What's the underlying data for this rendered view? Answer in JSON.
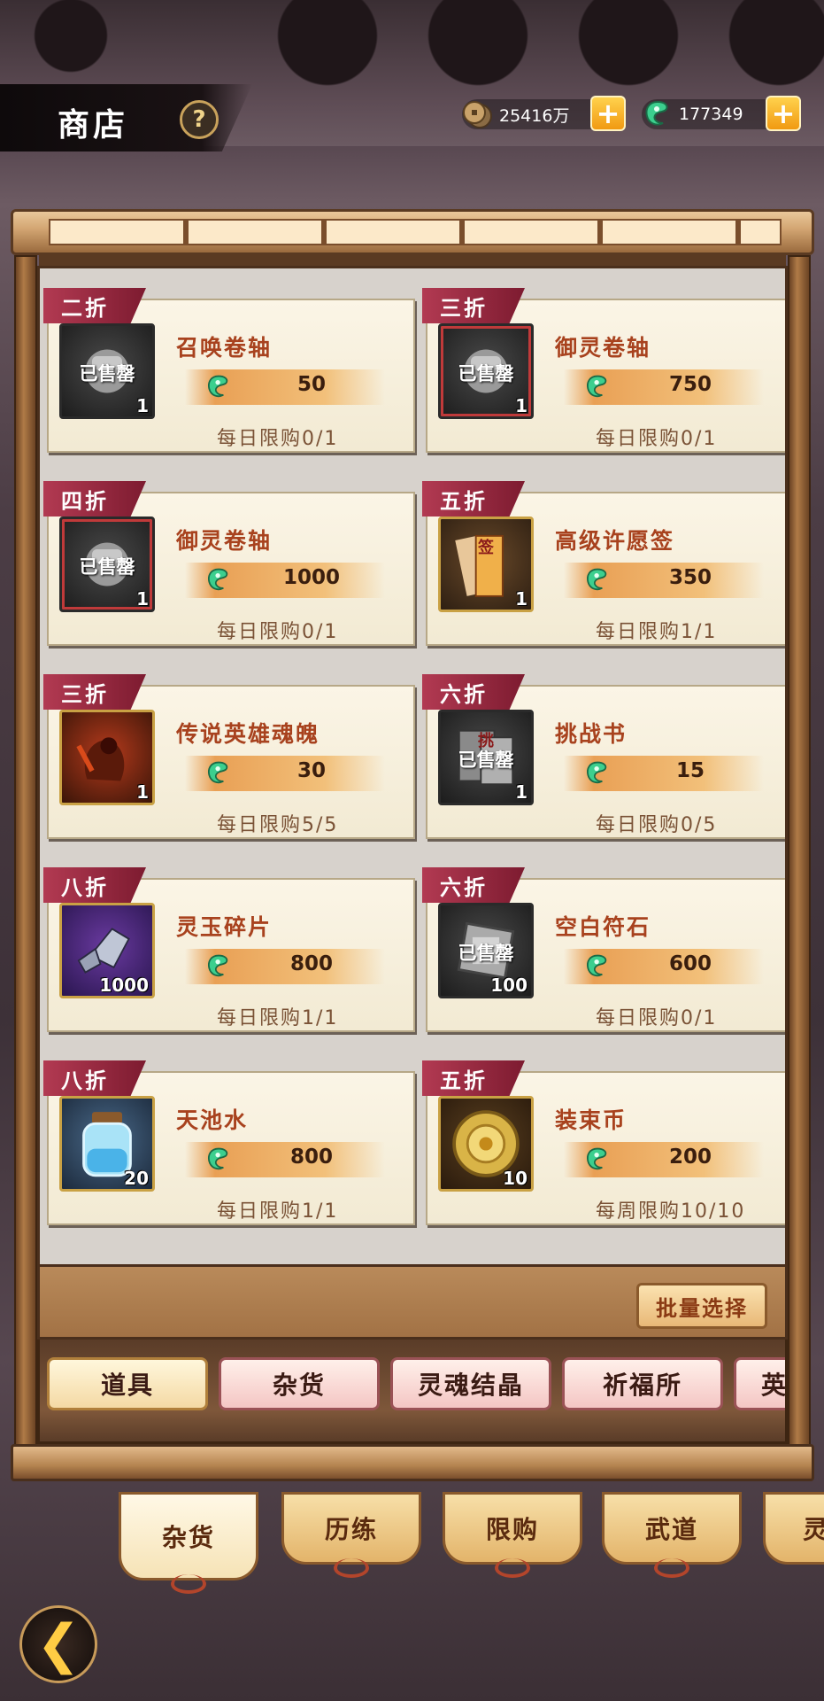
{
  "header": {
    "title": "商店",
    "help": "?"
  },
  "currencies": [
    {
      "icon": "copper-coin-icon",
      "value": "25416万"
    },
    {
      "icon": "jade-icon",
      "value": "177349"
    }
  ],
  "items": [
    {
      "discount": "二折",
      "name": "召唤卷轴",
      "price": "50",
      "limit": "每日限购0/1",
      "qty": "1",
      "sold_out": true,
      "sold_label": "已售罄",
      "icon": "scroll-icon"
    },
    {
      "discount": "三折",
      "name": "御灵卷轴",
      "price": "750",
      "limit": "每日限购0/1",
      "qty": "1",
      "sold_out": true,
      "sold_label": "已售罄",
      "icon": "scroll-icon"
    },
    {
      "discount": "四折",
      "name": "御灵卷轴",
      "price": "1000",
      "limit": "每日限购0/1",
      "qty": "1",
      "sold_out": true,
      "sold_label": "已售罄",
      "icon": "scroll-icon"
    },
    {
      "discount": "五折",
      "name": "高级许愿签",
      "price": "350",
      "limit": "每日限购1/1",
      "qty": "1",
      "sold_out": false,
      "label_on_icon": "签",
      "icon": "wish-tag-icon"
    },
    {
      "discount": "三折",
      "name": "传说英雄魂魄",
      "price": "30",
      "limit": "每日限购5/5",
      "qty": "1",
      "sold_out": false,
      "icon": "hero-soul-icon"
    },
    {
      "discount": "六折",
      "name": "挑战书",
      "price": "15",
      "limit": "每日限购0/5",
      "qty": "1",
      "sold_out": true,
      "sold_label": "已售罄",
      "label_on_icon": "挑",
      "icon": "challenge-book-icon"
    },
    {
      "discount": "八折",
      "name": "灵玉碎片",
      "price": "800",
      "limit": "每日限购1/1",
      "qty": "1000",
      "sold_out": false,
      "icon": "jade-shard-icon"
    },
    {
      "discount": "六折",
      "name": "空白符石",
      "price": "600",
      "limit": "每日限购0/1",
      "qty": "100",
      "sold_out": true,
      "sold_label": "已售罄",
      "icon": "rune-stone-icon"
    },
    {
      "discount": "八折",
      "name": "天池水",
      "price": "800",
      "limit": "每日限购1/1",
      "qty": "20",
      "sold_out": false,
      "icon": "water-jar-icon"
    },
    {
      "discount": "五折",
      "name": "装束币",
      "price": "200",
      "limit": "每周限购10/10",
      "qty": "10",
      "sold_out": false,
      "icon": "costume-coin-icon"
    }
  ],
  "batch_select": "批量选择",
  "category_tabs": [
    "道具",
    "杂货",
    "灵魂结晶",
    "祈福所",
    "英"
  ],
  "shop_tabs": [
    "杂货",
    "历练",
    "限购",
    "武道",
    "灵"
  ],
  "colors": {
    "discount_tag": "#9c2a42",
    "item_name": "#a8421e",
    "price_bar": "#e9a055"
  }
}
